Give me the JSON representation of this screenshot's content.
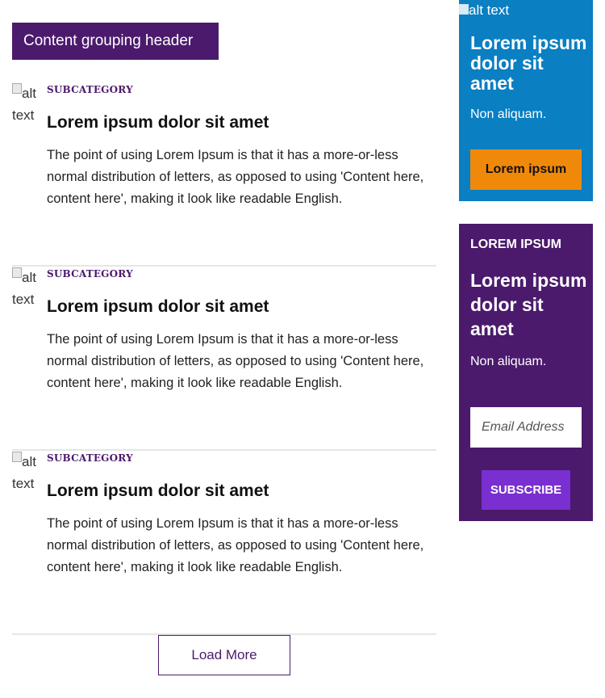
{
  "group_header": "Content grouping header",
  "articles": [
    {
      "image_alt": "alt text",
      "subcategory": "SUBCATEGORY",
      "title": "Lorem ipsum dolor sit amet",
      "description": "The point of using Lorem Ipsum is that it has a more-or-less normal distribution of letters, as opposed to using 'Content here, content here', making it look like readable English."
    },
    {
      "image_alt": "alt text",
      "subcategory": "SUBCATEGORY",
      "title": "Lorem ipsum dolor sit amet",
      "description": "The point of using Lorem Ipsum is that it has a more-or-less normal distribution of letters, as opposed to using 'Content here, content here', making it look like readable English."
    },
    {
      "image_alt": "alt text",
      "subcategory": "SUBCATEGORY",
      "title": "Lorem ipsum dolor sit amet",
      "description": "The point of using Lorem Ipsum is that it has a more-or-less normal distribution of letters, as opposed to using 'Content here, content here', making it look like readable English."
    }
  ],
  "load_more_label": "Load More",
  "promo": {
    "image_alt": "alt text",
    "title": "Lorem ipsum dolor sit amet",
    "text": "Non aliquam.",
    "button_label": "Lorem ipsum",
    "colors": {
      "background": "#0a7fc2",
      "button": "#f0890a"
    }
  },
  "newsletter": {
    "eyebrow": "LOREM IPSUM",
    "title": "Lorem ipsum dolor sit amet",
    "text": "Non aliquam.",
    "email_placeholder": "Email Address",
    "subscribe_label": "SUBSCRIBE",
    "colors": {
      "background": "#4b1a6c",
      "button": "#7a2fd0"
    }
  },
  "icons": [
    "broken-image-icon"
  ],
  "colors": {
    "accent": "#4b1a6c",
    "divider": "#e6e6e6"
  }
}
